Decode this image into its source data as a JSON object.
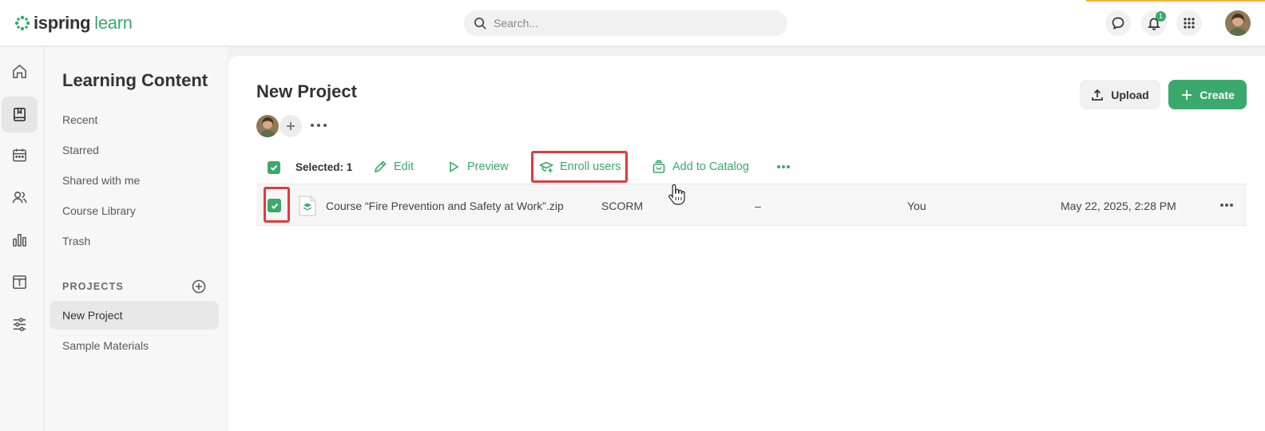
{
  "app": {
    "logo_part1": "ispring",
    "logo_part2": "learn",
    "accent": "#3aa96b"
  },
  "header": {
    "search_placeholder": "Search...",
    "notifications_count": "1",
    "icons": [
      "chat-icon",
      "bell-icon",
      "apps-grid-icon",
      "user-avatar"
    ]
  },
  "rail": {
    "items": [
      "home-icon",
      "book-icon",
      "calendar-icon",
      "users-icon",
      "reports-icon",
      "info-panel-icon",
      "sliders-icon"
    ],
    "active": "book-icon"
  },
  "sidebar": {
    "title": "Learning Content",
    "links": [
      "Recent",
      "Starred",
      "Shared with me",
      "Course Library",
      "Trash"
    ],
    "projects_header": "PROJECTS",
    "projects": [
      "New Project",
      "Sample Materials"
    ],
    "active_project": "New Project"
  },
  "main": {
    "title": "New Project",
    "upload_label": "Upload",
    "create_label": "Create",
    "toolbar": {
      "selected": "Selected: 1",
      "edit": "Edit",
      "preview": "Preview",
      "enroll": "Enroll users",
      "add_catalog": "Add to Catalog"
    },
    "row": {
      "name": "Course “Fire Prevention and Safety at Work”.zip",
      "type": "SCORM",
      "placeholder": "–",
      "owner": "You",
      "date": "May 22, 2025, 2:28 PM",
      "checked": true
    }
  }
}
